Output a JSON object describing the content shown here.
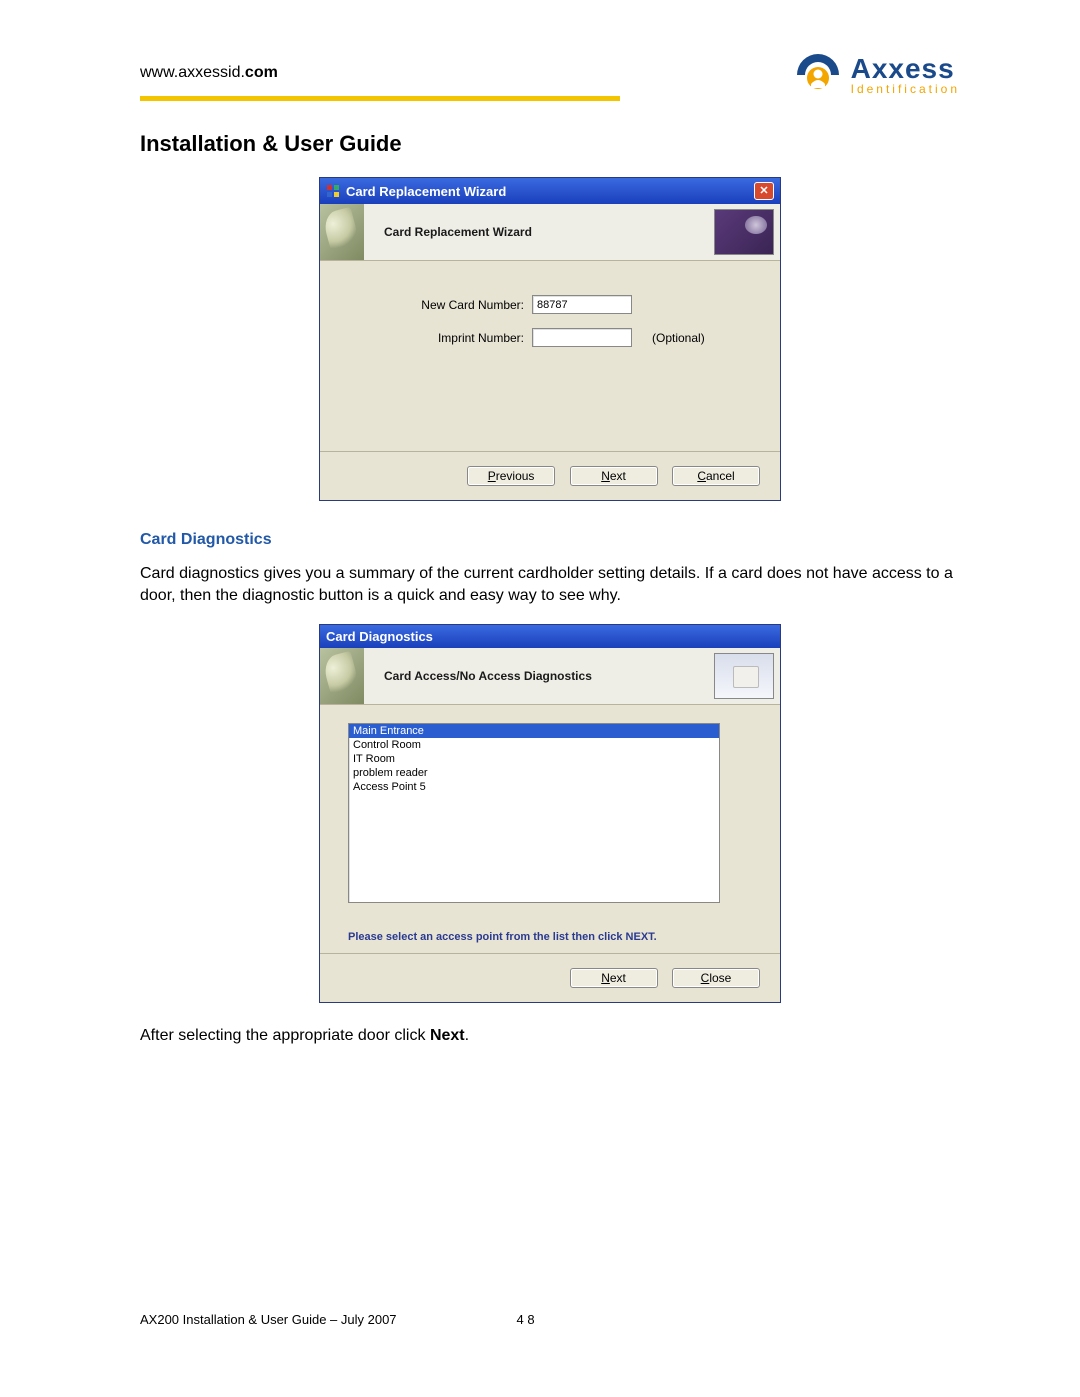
{
  "header": {
    "url_prefix": "www.axxessid.",
    "url_bold": "com",
    "brand_top": "Axxess",
    "brand_bottom": "Identification"
  },
  "page": {
    "title": "Installation & User Guide",
    "section_title": "Card Diagnostics",
    "paragraph1": "Card diagnostics gives you a summary of the current cardholder setting details. If a card does not have access to a door, then the diagnostic button is a quick and easy way to see why.",
    "paragraph2_prefix": "After selecting the appropriate door click ",
    "paragraph2_bold": "Next",
    "paragraph2_suffix": "."
  },
  "dialog1": {
    "title": "Card Replacement Wizard",
    "header_text": "Card Replacement Wizard",
    "fields": {
      "new_card_label": "New Card Number:",
      "new_card_value": "88787",
      "imprint_label": "Imprint Number:",
      "imprint_value": "",
      "optional_label": "(Optional)"
    },
    "buttons": {
      "previous": "Previous",
      "next": "Next",
      "cancel": "Cancel"
    }
  },
  "dialog2": {
    "title": "Card Diagnostics",
    "header_text": "Card Access/No Access Diagnostics",
    "list": [
      "Main Entrance",
      "Control Room",
      "IT Room",
      "problem reader",
      "Access Point 5"
    ],
    "selected_index": 0,
    "hint": "Please select an access point from the list then click NEXT.",
    "buttons": {
      "next": "Next",
      "close": "Close"
    }
  },
  "footer": {
    "left": "AX200 Installation & User Guide – July 2007",
    "page": "4 8"
  }
}
